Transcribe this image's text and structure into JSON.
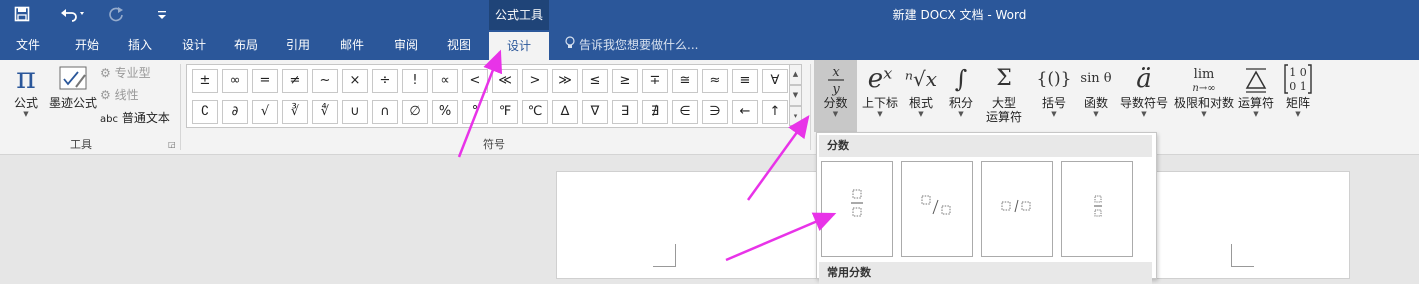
{
  "quick_access": {
    "save_icon": "save-icon",
    "undo_icon": "undo-icon",
    "redo_icon": "redo-icon",
    "customize_icon": "customize-icon"
  },
  "context_tab": "公式工具",
  "document_title": "新建 DOCX 文档 - Word",
  "tabs": [
    {
      "label": "文件"
    },
    {
      "label": "开始"
    },
    {
      "label": "插入"
    },
    {
      "label": "设计"
    },
    {
      "label": "布局"
    },
    {
      "label": "引用"
    },
    {
      "label": "邮件"
    },
    {
      "label": "审阅"
    },
    {
      "label": "视图"
    },
    {
      "label": "设计"
    }
  ],
  "tell_me": "告诉我您想要做什么...",
  "tools_group": {
    "formula_label": "公式",
    "ink_label": "墨迹公式",
    "professional": "专业型",
    "linear": "线性",
    "normal_text": "普通文本",
    "normal_text_prefix": "abc",
    "group_label": "工具"
  },
  "symbols_group": {
    "label": "符号",
    "row1": [
      "±",
      "∞",
      "=",
      "≠",
      "~",
      "×",
      "÷",
      "!",
      "∝",
      "<",
      "≪",
      ">",
      "≫",
      "≤",
      "≥",
      "∓",
      "≅",
      "≈",
      "≡",
      "∀"
    ],
    "row2": [
      "∁",
      "∂",
      "√",
      "∛",
      "∜",
      "∪",
      "∩",
      "∅",
      "%",
      "°",
      "℉",
      "℃",
      "∆",
      "∇",
      "∃",
      "∄",
      "∈",
      "∋",
      "←",
      "↑"
    ]
  },
  "structures": [
    {
      "label": "分数",
      "label2": "",
      "icon": "x/y"
    },
    {
      "label": "上下标",
      "label2": "",
      "icon": "eˣ"
    },
    {
      "label": "根式",
      "label2": "",
      "icon": "ⁿ√x"
    },
    {
      "label": "积分",
      "label2": "",
      "icon": "∫"
    },
    {
      "label": "大型",
      "label2": "运算符",
      "icon": "Σ"
    },
    {
      "label": "括号",
      "label2": "",
      "icon": "{()}"
    },
    {
      "label": "函数",
      "label2": "",
      "icon": "sin θ"
    },
    {
      "label": "导数符号",
      "label2": "",
      "icon": "ä"
    },
    {
      "label": "极限和对数",
      "label2": "",
      "icon": "lim"
    },
    {
      "label": "运算符",
      "label2": "",
      "icon": "Δ"
    },
    {
      "label": "矩阵",
      "label2": "",
      "icon": "[10/01]"
    }
  ],
  "dropdown": {
    "section1": "分数",
    "section2": "常用分数",
    "items": [
      "stacked-fraction",
      "skewed-fraction",
      "linear-fraction",
      "small-fraction"
    ]
  },
  "colors": {
    "ribbon_blue": "#2b579a",
    "annotation_arrow": "#e833e8"
  }
}
